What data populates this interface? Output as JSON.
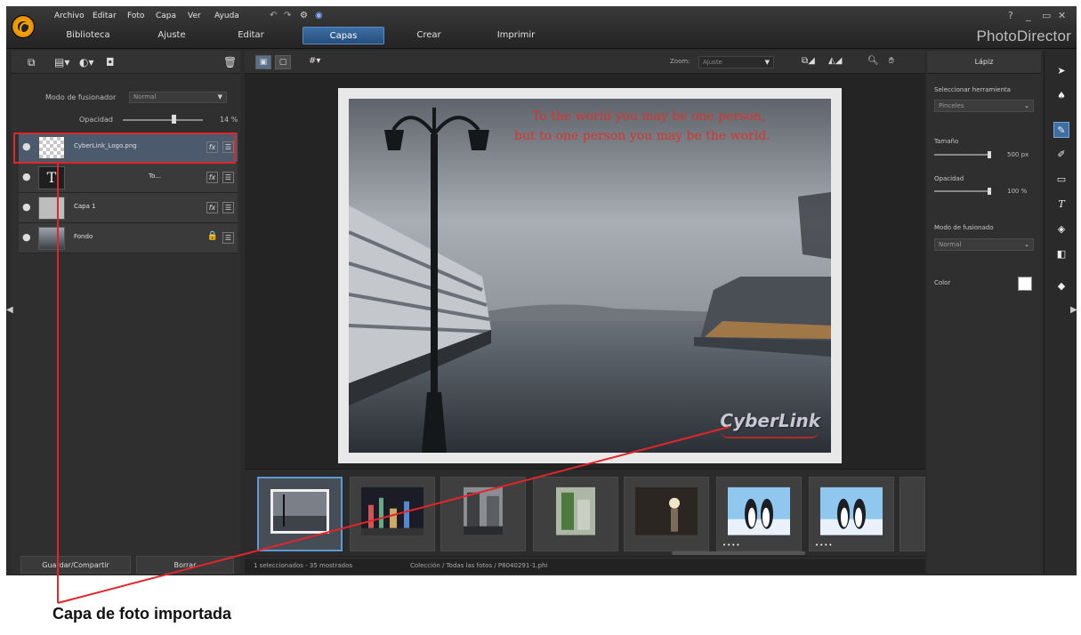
{
  "app": {
    "brand": "PhotoDirector",
    "menu": [
      "Archivo",
      "Editar",
      "Foto",
      "Capa",
      "Ver",
      "Ayuda"
    ],
    "modes": [
      "Biblioteca",
      "Ajuste",
      "Editar",
      "Capas",
      "Crear",
      "Imprimir"
    ],
    "active_mode": "Capas",
    "window_controls": [
      "?",
      "_",
      "▭",
      "✕"
    ]
  },
  "layers_panel": {
    "blend_label": "Modo de fusionador",
    "blend_value": "Normal",
    "opacity_label": "Opacidad",
    "opacity_value": "14 %",
    "layers": [
      {
        "name": "CyberLink_Logo.png",
        "kind": "checker",
        "selected": true,
        "locked": false
      },
      {
        "name": "To...",
        "kind": "text",
        "selected": false,
        "locked": false
      },
      {
        "name": "Capa 1",
        "kind": "gray",
        "selected": false,
        "locked": false
      },
      {
        "name": "Fondo",
        "kind": "photo",
        "selected": false,
        "locked": true
      }
    ],
    "save_share_button": "Guardar/Compartir",
    "delete_button": "Borrar"
  },
  "viewer": {
    "zoom_label": "Zoom:",
    "zoom_value": "Ajuste",
    "quote_line1": "To the world you may be one person,",
    "quote_line2": "but to one person you may be the world.",
    "watermark": "CyberLink"
  },
  "filmstrip": {
    "stars": "••••",
    "status_selection": "1 seleccionados - 35 mostrados",
    "status_path": "Colección / Todas las fotos / P8040291-1.phi"
  },
  "tool_panel": {
    "title": "Lápiz",
    "select_tool_label": "Seleccionar herramienta",
    "tool_value": "Pinceles",
    "size_label": "Tamaño",
    "size_value": "500 px",
    "opacity_label": "Opacidad",
    "opacity_value": "100 %",
    "blend_label": "Modo de fusionado",
    "blend_value": "Normal",
    "color_label": "Color",
    "color_value": "#ffffff"
  },
  "annotation": {
    "caption": "Capa de foto importada",
    "color": "#e0262b"
  }
}
